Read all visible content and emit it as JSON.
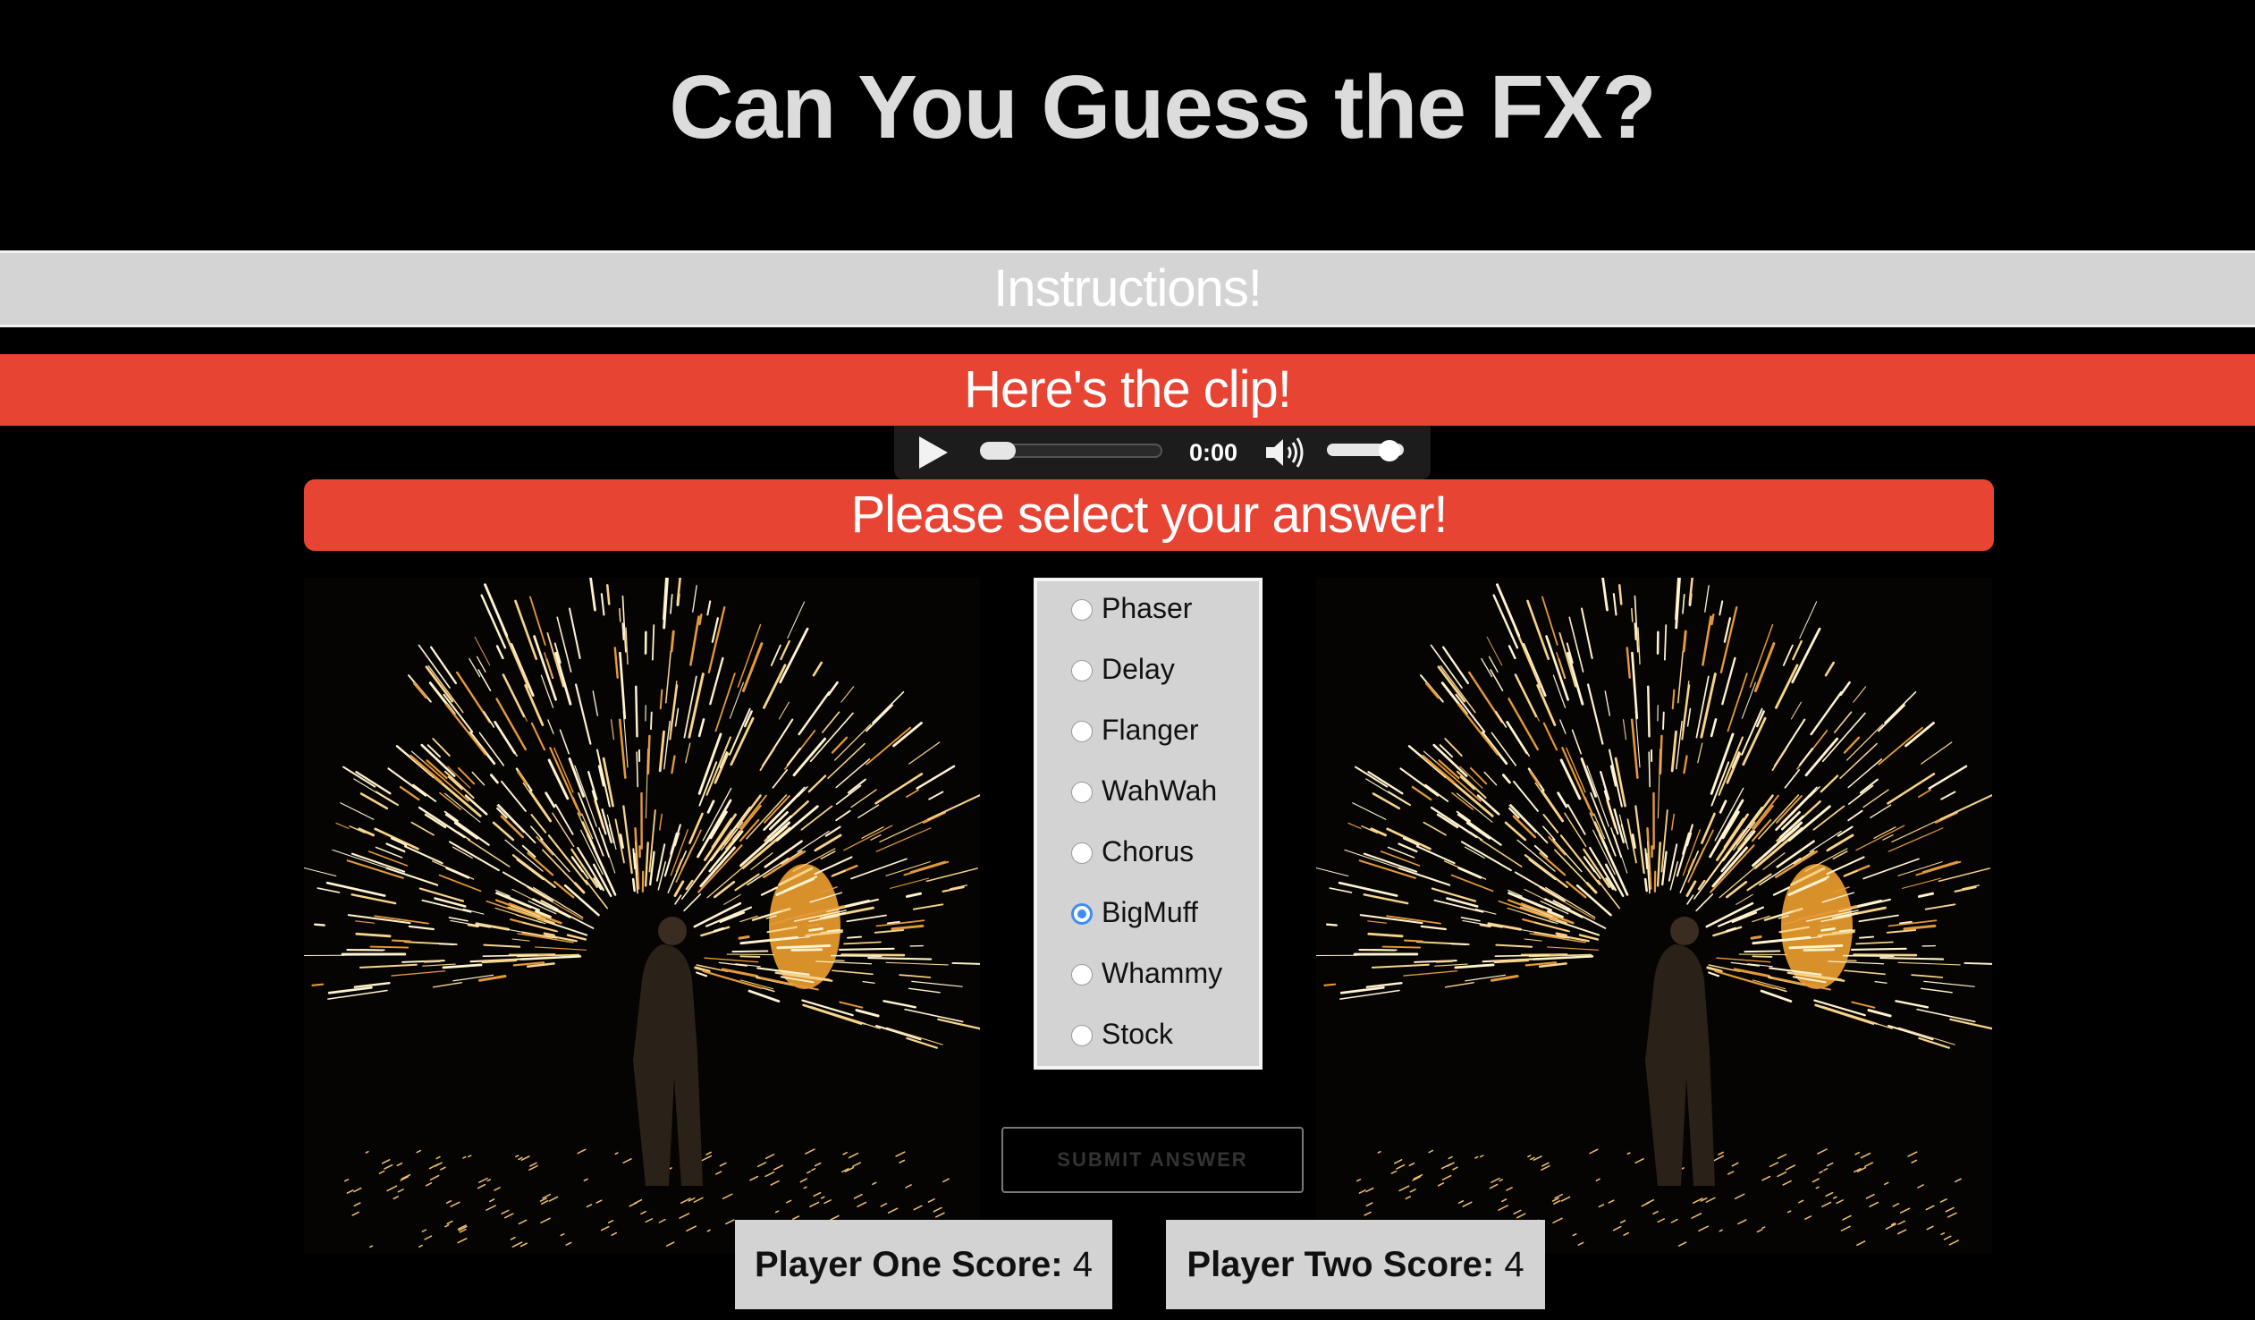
{
  "title": "Can You Guess the FX?",
  "instructions_label": "Instructions!",
  "clip_heading": "Here's the clip!",
  "audio_player": {
    "time": "0:00",
    "progress": 0,
    "volume": 0.85
  },
  "prompt": "Please select your answer!",
  "options": [
    {
      "label": "Phaser",
      "selected": false
    },
    {
      "label": "Delay",
      "selected": false
    },
    {
      "label": "Flanger",
      "selected": false
    },
    {
      "label": "WahWah",
      "selected": false
    },
    {
      "label": "Chorus",
      "selected": false
    },
    {
      "label": "BigMuff",
      "selected": true
    },
    {
      "label": "Whammy",
      "selected": false
    },
    {
      "label": "Stock",
      "selected": false
    }
  ],
  "submit_label": "SUBMIT ANSWER",
  "scores": {
    "player_one_label": "Player One Score:",
    "player_one_value": "4",
    "player_two_label": "Player Two Score:",
    "player_two_value": "4"
  },
  "colors": {
    "accent_red": "#e74433",
    "bar_gray": "#d4d4d4",
    "radio_selected": "#3c8ef3"
  }
}
